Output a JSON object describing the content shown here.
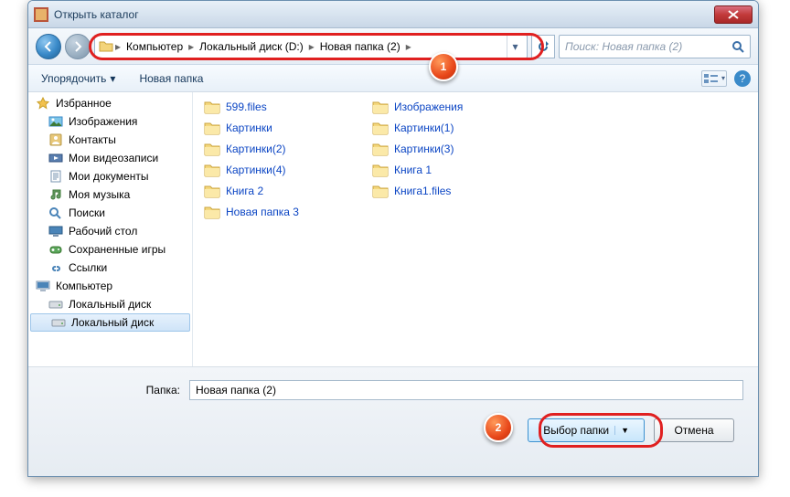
{
  "title": "Открыть каталог",
  "nav": {
    "segments": [
      "Компьютер",
      "Локальный диск (D:)",
      "Новая папка (2)"
    ],
    "search_placeholder": "Поиск: Новая папка (2)"
  },
  "toolbar": {
    "organize": "Упорядочить",
    "new_folder": "Новая папка"
  },
  "sidebar": {
    "items": [
      {
        "label": "Избранное",
        "icon": "star",
        "lvl": 0
      },
      {
        "label": "Изображения",
        "icon": "pic",
        "lvl": 1
      },
      {
        "label": "Контакты",
        "icon": "contacts",
        "lvl": 1
      },
      {
        "label": "Мои видеозаписи",
        "icon": "video",
        "lvl": 1
      },
      {
        "label": "Мои документы",
        "icon": "docs",
        "lvl": 1
      },
      {
        "label": "Моя музыка",
        "icon": "music",
        "lvl": 1
      },
      {
        "label": "Поиски",
        "icon": "search",
        "lvl": 1
      },
      {
        "label": "Рабочий стол",
        "icon": "desktop",
        "lvl": 1
      },
      {
        "label": "Сохраненные игры",
        "icon": "games",
        "lvl": 1
      },
      {
        "label": "Ссылки",
        "icon": "links",
        "lvl": 1
      },
      {
        "label": "Компьютер",
        "icon": "computer",
        "lvl": 0
      },
      {
        "label": "Локальный диск",
        "icon": "drive",
        "lvl": 1
      },
      {
        "label": "Локальный диск",
        "icon": "drive",
        "lvl": 1,
        "sel": true
      }
    ]
  },
  "folders_col1": [
    "599.files",
    "Картинки",
    "Картинки(2)",
    "Картинки(4)",
    "Книга 2",
    "Новая папка 3"
  ],
  "folders_col2": [
    "Изображения",
    "Картинки(1)",
    "Картинки(3)",
    "Книга 1",
    "Книга1.files"
  ],
  "footer": {
    "label": "Папка:",
    "value": "Новая папка (2)",
    "select": "Выбор папки",
    "cancel": "Отмена"
  },
  "badges": {
    "b1": "1",
    "b2": "2"
  }
}
